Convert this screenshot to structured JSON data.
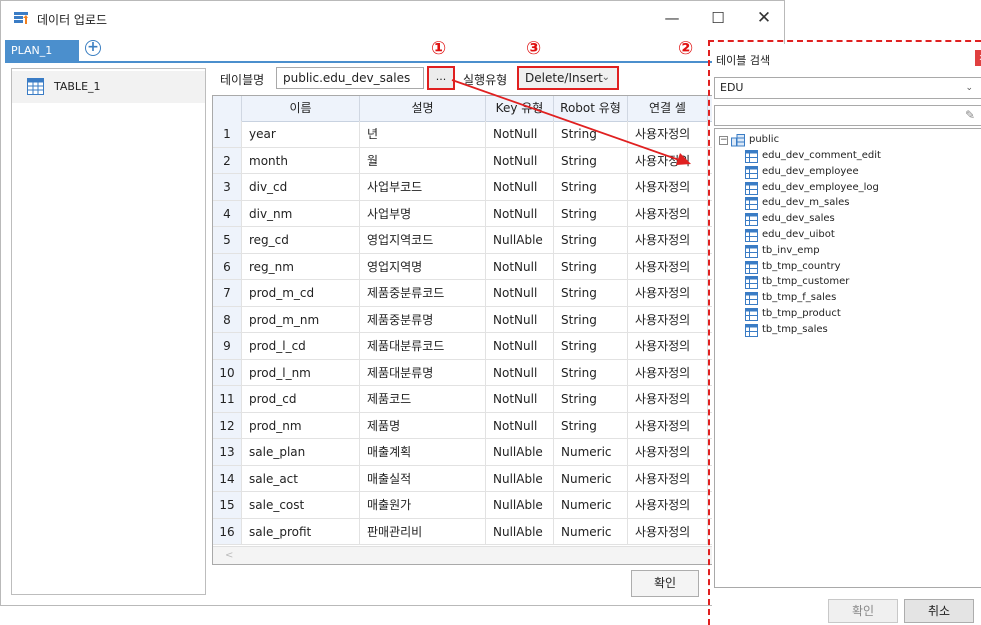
{
  "window": {
    "title": "데이터 업로드",
    "minimize": "—",
    "maximize": "☐",
    "close": "✕"
  },
  "plan_tab": {
    "label": "PLAN_1",
    "add": "+"
  },
  "table_list": {
    "items": [
      {
        "label": "TABLE_1"
      }
    ]
  },
  "form": {
    "table_name_label": "테이블명",
    "table_name_value": "public.edu_dev_sales",
    "browse_label": "...",
    "exec_type_label": "실행유형",
    "exec_type_value": "Delete/Insert"
  },
  "markers": {
    "m1": "①",
    "m2": "②",
    "m3": "③"
  },
  "grid": {
    "columns": [
      "이름",
      "설명",
      "Key 유형",
      "Robot 유형",
      "연결 셀"
    ],
    "rows": [
      {
        "no": "1",
        "name": "year",
        "desc": "년",
        "key": "NotNull",
        "robot": "String",
        "link": "사용자정의"
      },
      {
        "no": "2",
        "name": "month",
        "desc": "월",
        "key": "NotNull",
        "robot": "String",
        "link": "사용자정의"
      },
      {
        "no": "3",
        "name": "div_cd",
        "desc": "사업부코드",
        "key": "NotNull",
        "robot": "String",
        "link": "사용자정의"
      },
      {
        "no": "4",
        "name": "div_nm",
        "desc": "사업부명",
        "key": "NotNull",
        "robot": "String",
        "link": "사용자정의"
      },
      {
        "no": "5",
        "name": "reg_cd",
        "desc": "영업지역코드",
        "key": "NullAble",
        "robot": "String",
        "link": "사용자정의"
      },
      {
        "no": "6",
        "name": "reg_nm",
        "desc": "영업지역명",
        "key": "NotNull",
        "robot": "String",
        "link": "사용자정의"
      },
      {
        "no": "7",
        "name": "prod_m_cd",
        "desc": "제품중분류코드",
        "key": "NotNull",
        "robot": "String",
        "link": "사용자정의"
      },
      {
        "no": "8",
        "name": "prod_m_nm",
        "desc": "제품중분류명",
        "key": "NotNull",
        "robot": "String",
        "link": "사용자정의"
      },
      {
        "no": "9",
        "name": "prod_l_cd",
        "desc": "제품대분류코드",
        "key": "NotNull",
        "robot": "String",
        "link": "사용자정의"
      },
      {
        "no": "10",
        "name": "prod_l_nm",
        "desc": "제품대분류명",
        "key": "NotNull",
        "robot": "String",
        "link": "사용자정의"
      },
      {
        "no": "11",
        "name": "prod_cd",
        "desc": "제품코드",
        "key": "NotNull",
        "robot": "String",
        "link": "사용자정의"
      },
      {
        "no": "12",
        "name": "prod_nm",
        "desc": "제품명",
        "key": "NotNull",
        "robot": "String",
        "link": "사용자정의"
      },
      {
        "no": "13",
        "name": "sale_plan",
        "desc": "매출계획",
        "key": "NullAble",
        "robot": "Numeric",
        "link": "사용자정의"
      },
      {
        "no": "14",
        "name": "sale_act",
        "desc": "매출실적",
        "key": "NullAble",
        "robot": "Numeric",
        "link": "사용자정의"
      },
      {
        "no": "15",
        "name": "sale_cost",
        "desc": "매출원가",
        "key": "NullAble",
        "robot": "Numeric",
        "link": "사용자정의"
      },
      {
        "no": "16",
        "name": "sale_profit",
        "desc": "판매관리비",
        "key": "NullAble",
        "robot": "Numeric",
        "link": "사용자정의"
      }
    ],
    "scroll_left": "<"
  },
  "confirm_label": "확인",
  "search_panel": {
    "title": "테이블 검색",
    "close": "x",
    "db_value": "EDU",
    "tree_root": "public",
    "tables": [
      "edu_dev_comment_edit",
      "edu_dev_employee",
      "edu_dev_employee_log",
      "edu_dev_m_sales",
      "edu_dev_sales",
      "edu_dev_uibot",
      "tb_inv_emp",
      "tb_tmp_country",
      "tb_tmp_customer",
      "tb_tmp_f_sales",
      "tb_tmp_product",
      "tb_tmp_sales"
    ],
    "confirm_label": "확인",
    "cancel_label": "취소"
  },
  "colors": {
    "accent": "#4b8fcd",
    "highlight": "#e02020",
    "header_bg": "#eef3fb"
  }
}
